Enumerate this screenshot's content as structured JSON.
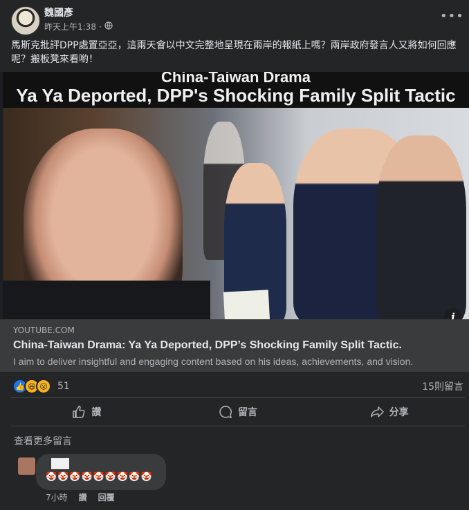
{
  "post": {
    "author": "魏國彥",
    "timestamp": "昨天上午1:38",
    "separator": "·",
    "audience_icon": "globe-icon",
    "text": "馬斯克批評DPP處置亞亞，這兩天會以中文完整地呈現在兩岸的報紙上嗎？兩岸政府發言人又將如何回應呢？搬板凳來看喲！"
  },
  "media": {
    "headline_line1": "China-Taiwan Drama",
    "headline_line2": "Ya Ya Deported, DPP's Shocking Family Split Tactic",
    "info_icon": "i"
  },
  "link": {
    "domain": "YOUTUBE.COM",
    "title": "China-Taiwan Drama: Ya Ya Deported, DPP’s Shocking Family Split Tactic.",
    "description": "I aim to deliver insightful and engaging content based on his ideas, achievements, and vision."
  },
  "reactions": {
    "types": [
      "like",
      "haha",
      "wow"
    ],
    "like_glyph": "👍",
    "haha_glyph": "😆",
    "wow_glyph": "😮",
    "count": "51",
    "comments": "15則留言"
  },
  "actions": {
    "like": "讚",
    "comment": "留言",
    "share": "分享"
  },
  "comments": {
    "view_more": "查看更多留言",
    "items": [
      {
        "text": "🤡🤡🤡🤡🤡🤡🤡🤡🤡",
        "time": "7小時",
        "like": "讚",
        "reply": "回覆"
      }
    ]
  },
  "colors": {
    "background": "#242526",
    "link_box": "#3a3b3c",
    "primary_text": "#e4e6eb",
    "secondary_text": "#b0b3b8",
    "like_blue": "#1877f2"
  }
}
